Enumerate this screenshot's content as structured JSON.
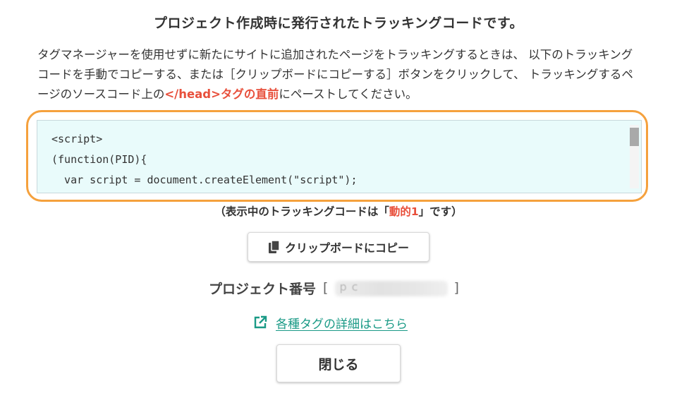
{
  "dialog": {
    "title": "プロジェクト作成時に発行されたトラッキングコードです。",
    "description": {
      "part1": "タグマネージャーを使用せずに新たにサイトに追加されたページをトラッキングするときは、 以下のトラッキングコードを手動でコピーする、または［クリップボードにコピーする］ボタンをクリックして、 トラッキングするページのソースコード上の",
      "highlight": "</head>タグの直前",
      "part2": "にペーストしてください。"
    },
    "code_lines": [
      "<script>",
      "(function(PID){",
      "  var script = document.createElement(\"script\");"
    ],
    "current_code": {
      "prefix": "（表示中のトラッキングコードは「",
      "name": "動的1",
      "suffix": "」です）"
    },
    "copy_button": {
      "label": "クリップボードにコピー",
      "icon": "copy-icon"
    },
    "project": {
      "label": "プロジェクト番号",
      "open_bracket": "[",
      "close_bracket": "]",
      "value_redacted": "p           c"
    },
    "detail_link": {
      "label": "各種タグの詳細はこちら",
      "icon": "external-link-icon"
    },
    "close_button": {
      "label": "閉じる"
    }
  },
  "colors": {
    "accent_highlight": "#e8503c",
    "outline_orange": "#f5a13d",
    "link_teal": "#1a9a86",
    "code_background": "#e9fbfb"
  }
}
